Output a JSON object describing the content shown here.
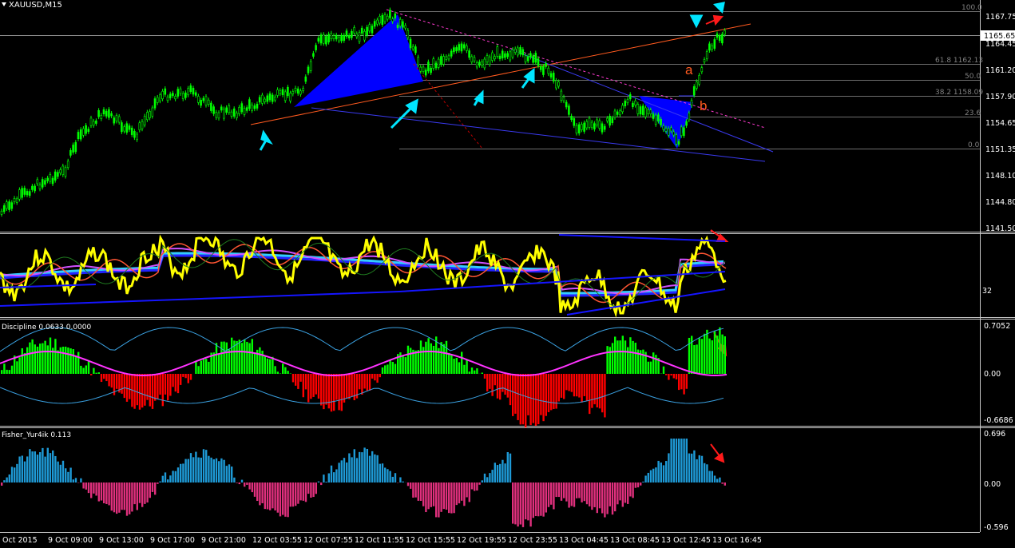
{
  "chart_header": {
    "title": "XAUUSD,M15"
  },
  "price_scale": {
    "labels": [
      "1167.75",
      "1164.45",
      "1161.20",
      "1157.90",
      "1154.65",
      "1151.35",
      "1148.10",
      "1144.80",
      "1141.50"
    ],
    "current_price": "1165.65"
  },
  "fib_levels": [
    "100.0",
    "61.8 1162.13",
    "50.0",
    "38.2 1158.09",
    "23.6",
    "0.0"
  ],
  "annotations": {
    "wave_a": "a",
    "wave_b": "b"
  },
  "indicator_panels": {
    "rsi": {
      "value_label": "32"
    },
    "discipline": {
      "title": "Discipline 0.0633 0.0000",
      "scale": [
        "0.7052",
        "0.00",
        "-0.6686"
      ]
    },
    "fisher": {
      "title": "Fisher_Yur4ik 0.113",
      "scale": [
        "0.696",
        "0.00",
        "-0.596"
      ]
    }
  },
  "time_axis": [
    "Oct 2015",
    "9 Oct 09:00",
    "9 Oct 13:00",
    "9 Oct 17:00",
    "9 Oct 21:00",
    "12 Oct 03:55",
    "12 Oct 07:55",
    "12 Oct 11:55",
    "12 Oct 15:55",
    "12 Oct 19:55",
    "12 Oct 23:55",
    "13 Oct 04:45",
    "13 Oct 08:45",
    "13 Oct 12:45",
    "13 Oct 16:45"
  ],
  "colors": {
    "bull": "#00ff00",
    "bear": "#ff0000",
    "accent": "#00e5ff",
    "fisher_up": "#1e9ad6",
    "fisher_down": "#e0307d"
  }
}
